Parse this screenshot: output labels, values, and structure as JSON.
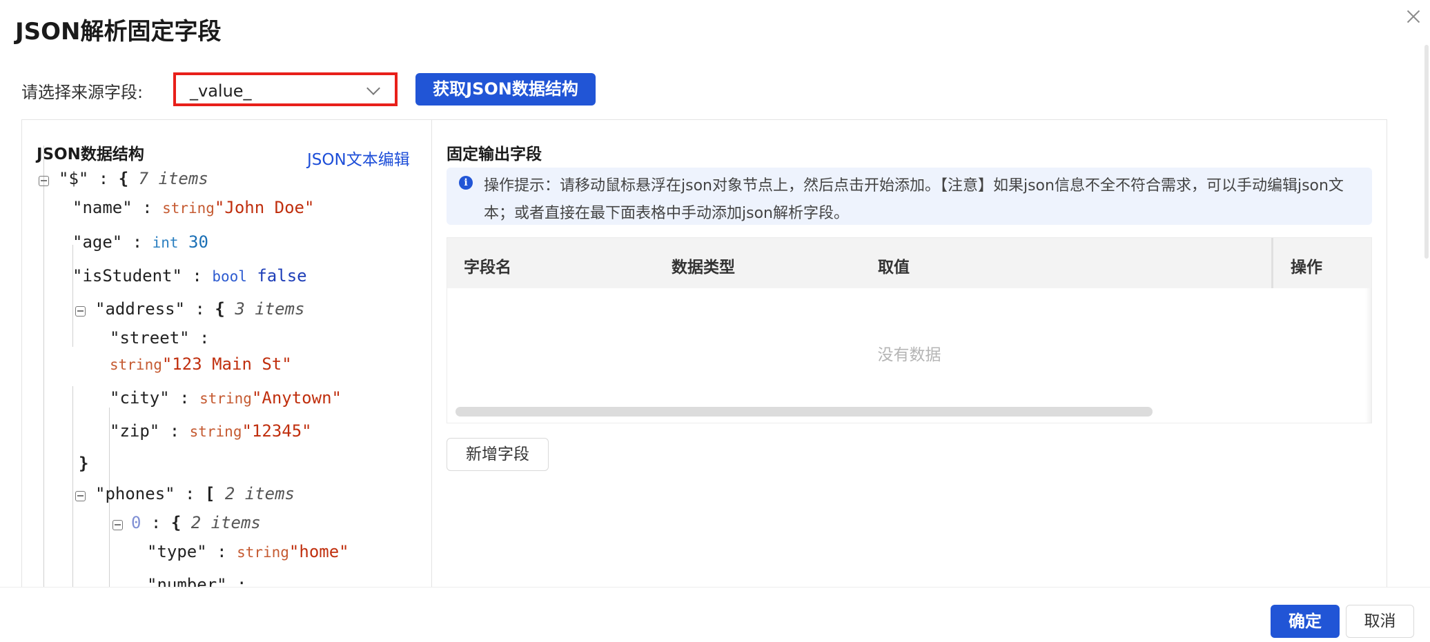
{
  "dialog": {
    "title": "JSON解析固定字段",
    "close_icon": "close-icon"
  },
  "source": {
    "label": "请选择来源字段:",
    "selected": "_value_",
    "fetch_button": "获取JSON数据结构"
  },
  "left_panel": {
    "title": "JSON数据结构",
    "edit_link": "JSON文本编辑",
    "tree": {
      "root": {
        "key": "\"$\"",
        "count": "7 items"
      },
      "name": {
        "key": "\"name\"",
        "type": "string",
        "value": "\"John Doe\""
      },
      "age": {
        "key": "\"age\"",
        "type": "int",
        "value": "30"
      },
      "isStudent": {
        "key": "\"isStudent\"",
        "type": "bool",
        "value": "false"
      },
      "address": {
        "key": "\"address\"",
        "count": "3 items",
        "street": {
          "key": "\"street\"",
          "type": "string",
          "value": "\"123 Main St\""
        },
        "city": {
          "key": "\"city\"",
          "type": "string",
          "value": "\"Anytown\""
        },
        "zip": {
          "key": "\"zip\"",
          "type": "string",
          "value": "\"12345\""
        }
      },
      "phones": {
        "key": "\"phones\"",
        "count": "2 items",
        "item0": {
          "index": "0",
          "count": "2 items",
          "type_field": {
            "key": "\"type\"",
            "type": "string",
            "value": "\"home\""
          },
          "number_field": {
            "key": "\"number\""
          }
        }
      }
    }
  },
  "right_panel": {
    "title": "固定输出字段",
    "tip": "操作提示：请移动鼠标悬浮在json对象节点上，然后点击开始添加。【注意】如果json信息不全不符合需求，可以手动编辑json文本；或者直接在最下面表格中手动添加json解析字段。",
    "table": {
      "columns": [
        "字段名",
        "数据类型",
        "取值",
        "操作"
      ],
      "rows": [],
      "empty_text": "没有数据"
    },
    "add_button": "新增字段"
  },
  "footer": {
    "ok": "确定",
    "cancel": "取消"
  },
  "colors": {
    "primary": "#2155d6",
    "highlight_border": "#e8201a",
    "string_value": "#c02f0e",
    "link": "#1d4ed8"
  }
}
